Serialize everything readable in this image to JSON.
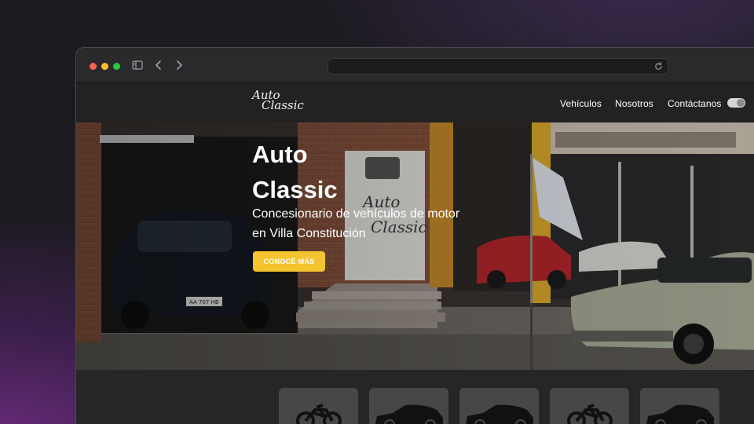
{
  "browser": {
    "address_value": "",
    "icons": [
      "sidebar-icon",
      "back-icon",
      "forward-icon",
      "reload-icon"
    ]
  },
  "site": {
    "logo": {
      "line1": "Auto",
      "line2": "Classic"
    },
    "nav": [
      {
        "label": "Vehículos"
      },
      {
        "label": "Nosotros"
      },
      {
        "label": "Contáctanos"
      }
    ],
    "theme_toggle": {
      "icon": "toggle-switch-icon"
    }
  },
  "hero": {
    "title_line1": "Auto",
    "title_line2": "Classic",
    "subtitle_line1": "Concesionario de vehículos de motor",
    "subtitle_line2": "en Villa Constitución",
    "cta_label": "CONOCÉ MÁS",
    "cta_color": "#f4c430"
  },
  "categories": [
    {
      "icon": "motorcycle-icon"
    },
    {
      "icon": "hatchback-car-icon"
    },
    {
      "icon": "hatchback-car-icon"
    },
    {
      "icon": "motorcycle-icon"
    },
    {
      "icon": "hatchback-car-icon"
    }
  ]
}
